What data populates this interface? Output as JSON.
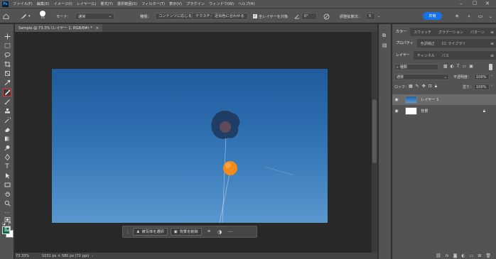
{
  "app": {
    "logo": "Ps"
  },
  "menu": [
    "ファイル(F)",
    "編集(E)",
    "イメージ(I)",
    "レイヤー(L)",
    "書式(Y)",
    "選択範囲(S)",
    "フィルター(T)",
    "表示(V)",
    "プラグイン",
    "ウィンドウ(W)",
    "ヘルプ(H)"
  ],
  "options": {
    "brush_size": "16",
    "mode_label": "モード：",
    "mode_value": "通常",
    "type_label": "種類：",
    "btn_content_aware": "コンテンツに応じる",
    "btn_create_texture": "テクスチャを作成",
    "btn_proximity": "近似色に合わせる",
    "sample_all_layers": "全レイヤーを対象",
    "angle": "0°",
    "diffusion_label": "調整拡散法：",
    "diffusion_value": "5",
    "share": "共有"
  },
  "document": {
    "tab_title": "Sample @ 73.3% (レイヤー 1, RGB/8#) *",
    "zoom": "73.33%",
    "size": "1031 px × 580 px (72 ppi)"
  },
  "context_bar": {
    "select_subject": "被写体を選択",
    "remove_background": "背景を削除"
  },
  "panels": {
    "row1_tabs": [
      "カラー",
      "スウォッチ",
      "グラデーション",
      "パターン"
    ],
    "row2_tabs": [
      "プロパティ",
      "色調補正",
      "CC ライブラリ"
    ],
    "layer_tabs": [
      "レイヤー",
      "チャンネル",
      "パス"
    ],
    "filter_kind": "種類",
    "blend_mode": "通常",
    "opacity_label": "不透明度：",
    "opacity_value": "100%",
    "lock_label": "ロック：",
    "fill_label": "塗り：",
    "fill_value": "100%"
  },
  "layers": [
    {
      "name": "レイヤー 1",
      "selected": true
    },
    {
      "name": "背景",
      "selected": false,
      "locked": true
    }
  ],
  "colors": {
    "accent": "#1473e6",
    "foreground": "#0a6b4a",
    "background": "#ffffff",
    "active_tool_border": "#e0383e"
  }
}
